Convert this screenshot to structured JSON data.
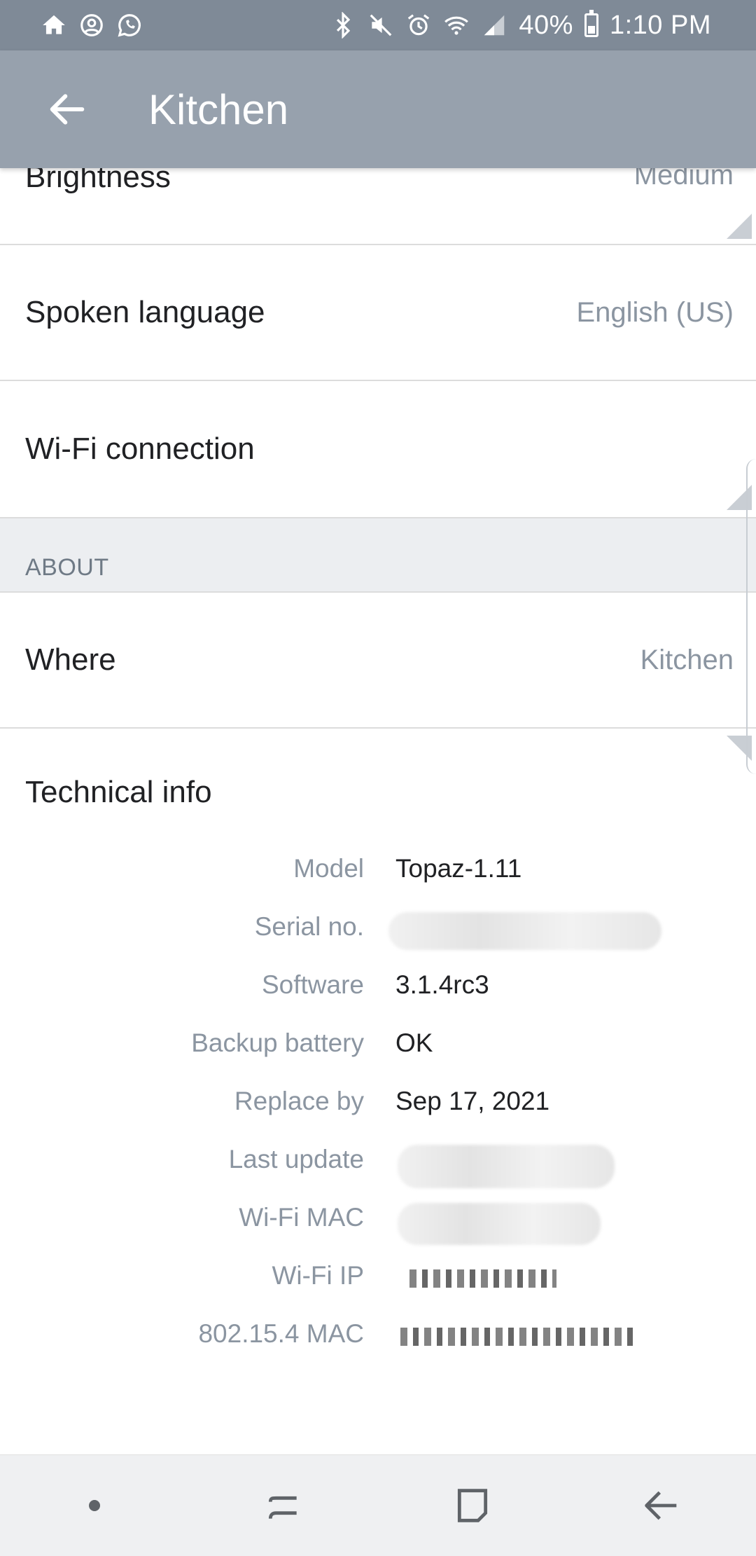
{
  "status_bar": {
    "battery_percent": "40%",
    "time": "1:10 PM",
    "left_icons": [
      "home-icon",
      "account-circle-icon",
      "whatsapp-icon"
    ],
    "right_icons": [
      "bluetooth-icon",
      "mute-icon",
      "alarm-icon",
      "wifi-icon",
      "signal-icon",
      "battery-icon"
    ]
  },
  "app_bar": {
    "title": "Kitchen",
    "back_icon": "arrow-left-icon"
  },
  "settings": {
    "brightness": {
      "label": "Brightness",
      "value": "Medium"
    },
    "spoken_language": {
      "label": "Spoken language",
      "value": "English (US)"
    },
    "wifi": {
      "label": "Wi-Fi connection"
    }
  },
  "about": {
    "header": "ABOUT",
    "where": {
      "label": "Where",
      "value": "Kitchen"
    }
  },
  "technical_info": {
    "title": "Technical info",
    "rows": [
      {
        "key": "Model",
        "value": "Topaz-1.11"
      },
      {
        "key": "Serial no.",
        "value": ""
      },
      {
        "key": "Software",
        "value": "3.1.4rc3"
      },
      {
        "key": "Backup battery",
        "value": "OK"
      },
      {
        "key": "Replace by",
        "value": "Sep 17, 2021"
      },
      {
        "key": "Last update",
        "value": ""
      },
      {
        "key": "Wi-Fi MAC",
        "value": ""
      },
      {
        "key": "Wi-Fi IP",
        "value": ""
      },
      {
        "key": "802.15.4 MAC",
        "value": ""
      }
    ]
  },
  "nav_bar": {
    "buttons": [
      "dot-icon",
      "recent-apps-icon",
      "home-square-icon",
      "back-arrow-icon"
    ]
  },
  "colors": {
    "status_bar": "#7f8a97",
    "app_bar": "#97a1ad",
    "section_header_bg": "#eceef1",
    "secondary_text": "#8b95a1"
  }
}
